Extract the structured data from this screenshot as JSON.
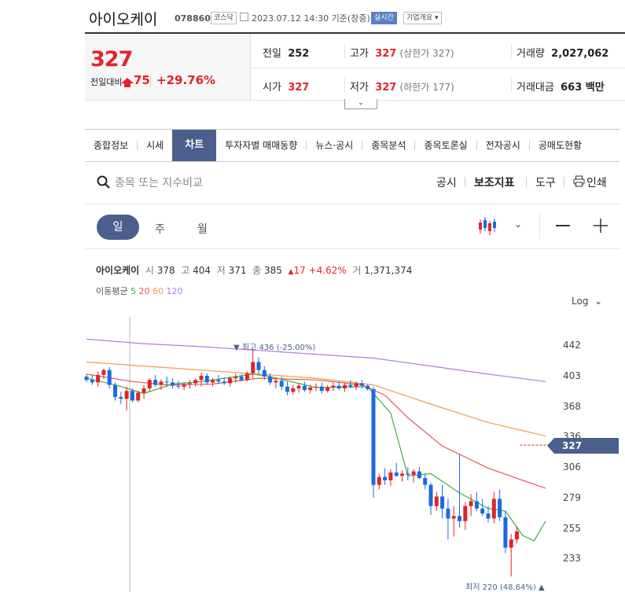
{
  "header": {
    "name": "아이오케이",
    "code": "078860",
    "market_badge": "코스닥",
    "datetime": "2023.07.12 14:30 기준(장중)",
    "realtime_badge": "실시간",
    "company_info_button": "기업개요"
  },
  "price": {
    "current": "327",
    "change_label": "전일대비",
    "change_value": "75",
    "change_rate": "+29.76%"
  },
  "stats": {
    "prev_close_label": "전일",
    "prev_close": "252",
    "high_label": "고가",
    "high": "327",
    "high_note": "(상한가 327)",
    "volume_label": "거래량",
    "volume": "2,027,062",
    "open_label": "시가",
    "open": "327",
    "low_label": "저가",
    "low": "327",
    "low_note": "(하한가 177)",
    "amount_label": "거래대금",
    "amount": "663 백만"
  },
  "tabs": [
    "종합정보",
    "시세",
    "차트",
    "투자자별 매매동향",
    "뉴스·공시",
    "종목분석",
    "종목토론실",
    "전자공시",
    "공매도현황"
  ],
  "search": {
    "placeholder": "종목 또는 지수비교"
  },
  "tools": {
    "disclosure": "공시",
    "indicators": "보조지표",
    "tools": "도구",
    "print": "인쇄"
  },
  "periods": {
    "day": "일",
    "week": "주",
    "month": "월"
  },
  "chart_info": {
    "name": "아이오케이",
    "open_label": "시",
    "open": "378",
    "high_label": "고",
    "high": "404",
    "low_label": "저",
    "low": "371",
    "close_label": "종",
    "close": "385",
    "change_arrow": "▲",
    "change": "17",
    "rate": "+4.62%",
    "volume_label": "거",
    "volume": "1,371,374"
  },
  "ma": {
    "label": "이동평균",
    "p5": "5",
    "p20": "20",
    "p60": "60",
    "p120": "120",
    "colors": {
      "p5": "#3cb043",
      "p20": "#e05a5a",
      "p60": "#f39a4a",
      "p120": "#b27ae0"
    }
  },
  "scale": {
    "log_label": "Log"
  },
  "annotations": {
    "max_label": "▼ 최고 436 (-25.00%)",
    "min_label": "최저 220 (48.64%) ▲"
  },
  "current_tag": "327",
  "colors": {
    "up": "#e0242b",
    "down": "#1a6ae0",
    "accent": "#4a5f8c"
  },
  "chart_data": {
    "type": "candlestick",
    "scale": "log",
    "ylim": [
      220,
      470
    ],
    "y_ticks": [
      442,
      403,
      368,
      336,
      306,
      279,
      255,
      233
    ],
    "current_price": 327,
    "max": {
      "value": 436,
      "rate": "-25.00%"
    },
    "min": {
      "value": 220,
      "rate": "48.64%"
    },
    "candles": [
      [
        402,
        405,
        395,
        398
      ],
      [
        398,
        404,
        392,
        395
      ],
      [
        395,
        408,
        390,
        404
      ],
      [
        404,
        412,
        399,
        410
      ],
      [
        410,
        414,
        388,
        392
      ],
      [
        392,
        395,
        374,
        378
      ],
      [
        378,
        384,
        370,
        376
      ],
      [
        376,
        390,
        363,
        385
      ],
      [
        385,
        388,
        372,
        374
      ],
      [
        374,
        385,
        372,
        383
      ],
      [
        383,
        392,
        376,
        388
      ],
      [
        388,
        400,
        384,
        398
      ],
      [
        398,
        404,
        390,
        392
      ],
      [
        392,
        399,
        386,
        396
      ],
      [
        396,
        402,
        390,
        395
      ],
      [
        395,
        400,
        388,
        391
      ],
      [
        391,
        397,
        387,
        390
      ],
      [
        390,
        395,
        386,
        393
      ],
      [
        393,
        398,
        388,
        394
      ],
      [
        394,
        400,
        390,
        398
      ],
      [
        398,
        407,
        390,
        403
      ],
      [
        403,
        406,
        392,
        395
      ],
      [
        395,
        400,
        390,
        398
      ],
      [
        398,
        404,
        393,
        396
      ],
      [
        396,
        401,
        392,
        394
      ],
      [
        394,
        402,
        390,
        400
      ],
      [
        400,
        406,
        395,
        402
      ],
      [
        402,
        405,
        396,
        398
      ],
      [
        398,
        408,
        396,
        406
      ],
      [
        406,
        436,
        400,
        420
      ],
      [
        420,
        426,
        405,
        410
      ],
      [
        410,
        415,
        398,
        402
      ],
      [
        402,
        406,
        392,
        395
      ],
      [
        395,
        400,
        388,
        397
      ],
      [
        397,
        402,
        386,
        390
      ],
      [
        390,
        396,
        380,
        384
      ],
      [
        384,
        392,
        381,
        388
      ],
      [
        388,
        394,
        383,
        391
      ],
      [
        391,
        396,
        384,
        386
      ],
      [
        386,
        392,
        382,
        389
      ],
      [
        389,
        394,
        385,
        390
      ],
      [
        390,
        395,
        382,
        385
      ],
      [
        385,
        392,
        383,
        389
      ],
      [
        389,
        395,
        385,
        391
      ],
      [
        391,
        396,
        386,
        388
      ],
      [
        388,
        394,
        384,
        392
      ],
      [
        392,
        398,
        388,
        390
      ],
      [
        390,
        396,
        386,
        394
      ],
      [
        394,
        398,
        388,
        391
      ],
      [
        391,
        393,
        385,
        387
      ],
      [
        387,
        390,
        279,
        290
      ],
      [
        290,
        300,
        286,
        297
      ],
      [
        297,
        305,
        290,
        294
      ],
      [
        294,
        304,
        289,
        301
      ],
      [
        301,
        310,
        297,
        298
      ],
      [
        298,
        303,
        293,
        300
      ],
      [
        300,
        306,
        294,
        299
      ],
      [
        299,
        304,
        292,
        302
      ],
      [
        302,
        306,
        295,
        296
      ],
      [
        296,
        300,
        286,
        290
      ],
      [
        290,
        292,
        265,
        272
      ],
      [
        272,
        284,
        268,
        280
      ],
      [
        280,
        290,
        262,
        270
      ],
      [
        270,
        278,
        246,
        262
      ],
      [
        262,
        272,
        248,
        264
      ],
      [
        264,
        318,
        255,
        260
      ],
      [
        260,
        275,
        253,
        272
      ],
      [
        272,
        282,
        264,
        276
      ],
      [
        276,
        284,
        268,
        270
      ],
      [
        270,
        278,
        264,
        266
      ],
      [
        266,
        272,
        259,
        262
      ],
      [
        262,
        284,
        258,
        278
      ],
      [
        278,
        286,
        260,
        263
      ],
      [
        263,
        268,
        236,
        240
      ],
      [
        240,
        250,
        220,
        246
      ],
      [
        246,
        256,
        243,
        252
      ]
    ],
    "moving_averages": {
      "p5": [
        [
          0,
          400
        ],
        [
          5,
          392
        ],
        [
          10,
          382
        ],
        [
          15,
          393
        ],
        [
          20,
          396
        ],
        [
          29,
          405
        ],
        [
          32,
          402
        ],
        [
          40,
          389
        ],
        [
          49,
          390
        ],
        [
          53,
          360
        ],
        [
          56,
          298
        ],
        [
          60,
          300
        ],
        [
          65,
          283
        ],
        [
          70,
          270
        ],
        [
          73,
          268
        ],
        [
          76,
          249
        ],
        [
          78,
          245
        ],
        [
          80,
          260
        ]
      ],
      "p20": [
        [
          0,
          405
        ],
        [
          8,
          396
        ],
        [
          14,
          392
        ],
        [
          22,
          393
        ],
        [
          30,
          400
        ],
        [
          40,
          398
        ],
        [
          48,
          392
        ],
        [
          52,
          380
        ],
        [
          56,
          355
        ],
        [
          62,
          326
        ],
        [
          70,
          305
        ],
        [
          76,
          294
        ],
        [
          80,
          287
        ]
      ],
      "p60": [
        [
          0,
          420
        ],
        [
          10,
          415
        ],
        [
          20,
          410
        ],
        [
          30,
          405
        ],
        [
          40,
          400
        ],
        [
          50,
          392
        ],
        [
          60,
          370
        ],
        [
          70,
          350
        ],
        [
          80,
          336
        ]
      ],
      "p120": [
        [
          0,
          450
        ],
        [
          10,
          444
        ],
        [
          20,
          440
        ],
        [
          30,
          435
        ],
        [
          40,
          430
        ],
        [
          50,
          425
        ],
        [
          60,
          415
        ],
        [
          70,
          405
        ],
        [
          80,
          396
        ]
      ]
    }
  }
}
